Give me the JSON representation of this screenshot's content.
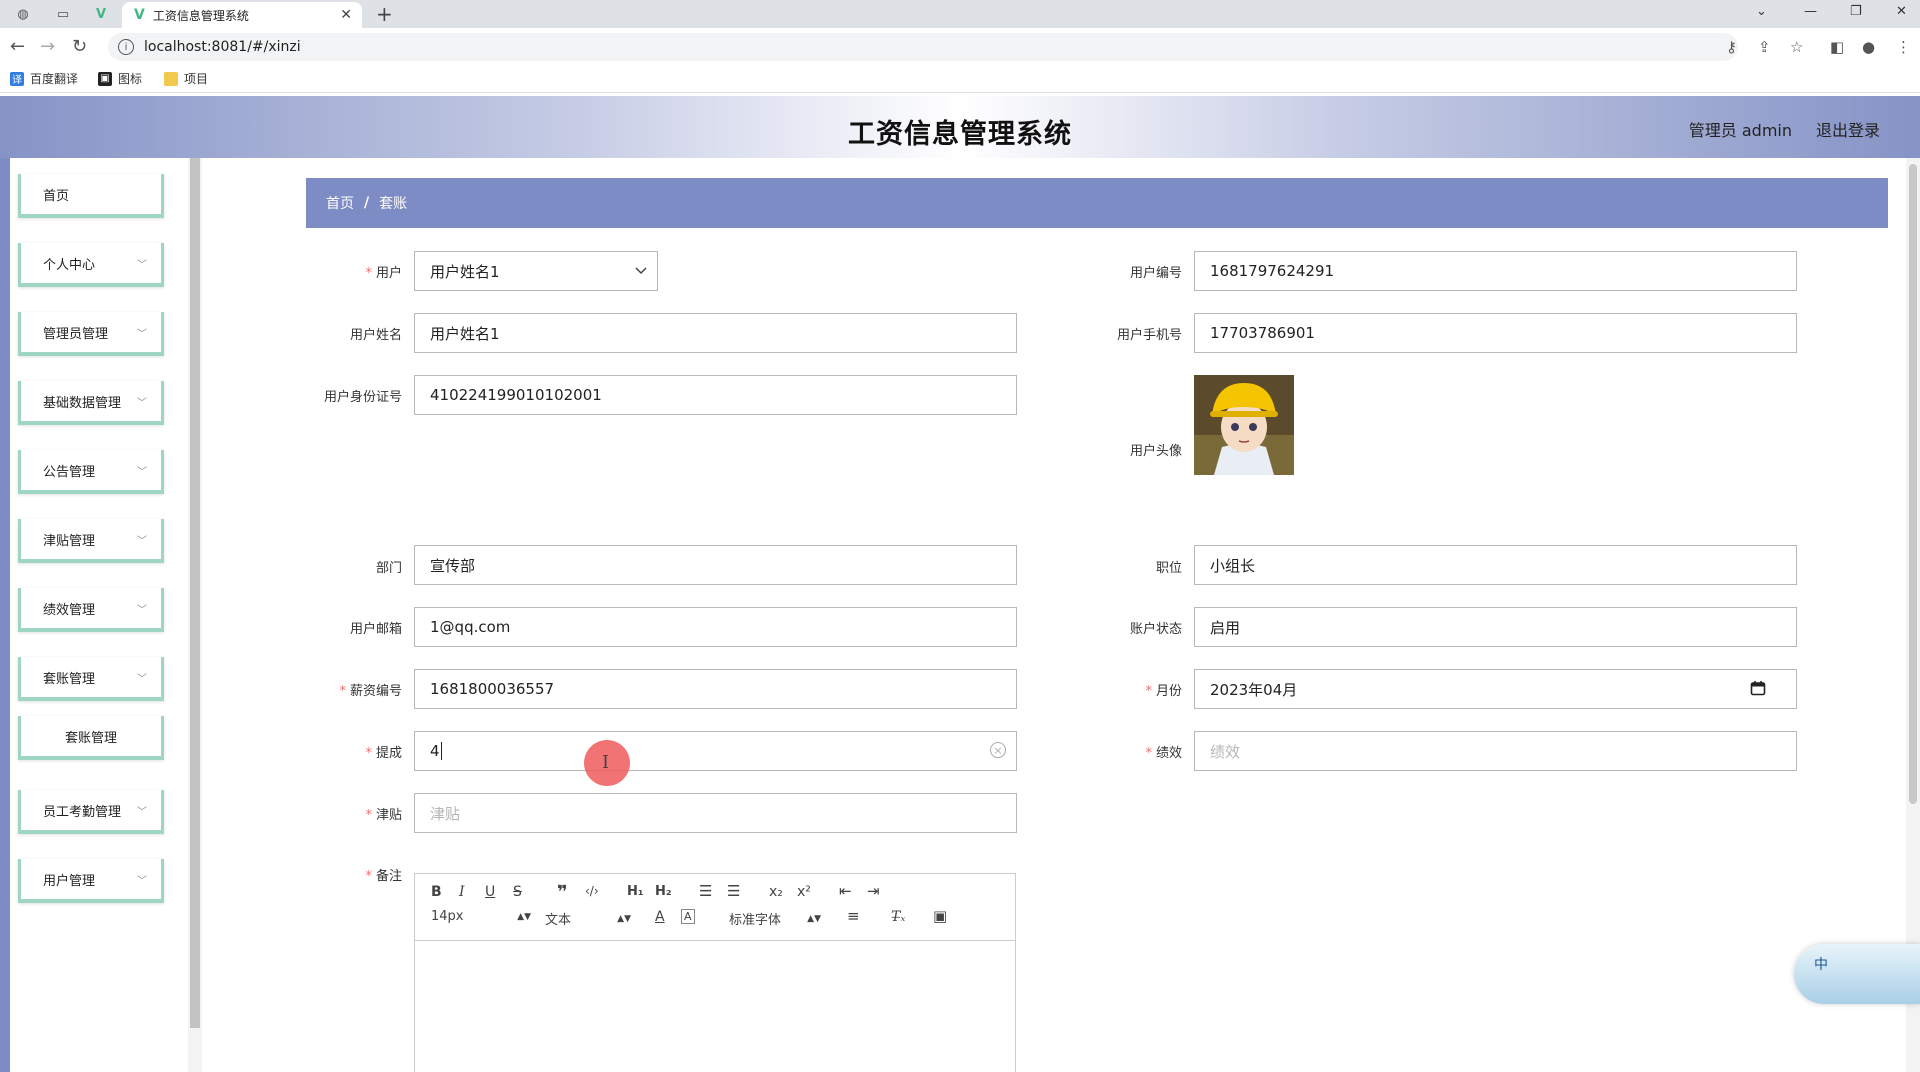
{
  "browser": {
    "tab_title": "工资信息管理系统",
    "url": "localhost:8081/#/xinzi",
    "bookmarks": [
      "百度翻译",
      "图标",
      "项目"
    ]
  },
  "header": {
    "title": "工资信息管理系统",
    "user": "管理员 admin",
    "logout": "退出登录"
  },
  "sidebar": {
    "items": [
      {
        "label": "首页"
      },
      {
        "label": "个人中心"
      },
      {
        "label": "管理员管理"
      },
      {
        "label": "基础数据管理"
      },
      {
        "label": "公告管理"
      },
      {
        "label": "津贴管理"
      },
      {
        "label": "绩效管理"
      },
      {
        "label": "套账管理"
      },
      {
        "label": "套账管理"
      },
      {
        "label": "员工考勤管理"
      },
      {
        "label": "用户管理"
      }
    ]
  },
  "breadcrumb": {
    "home": "首页",
    "sep": "/",
    "current": "套账"
  },
  "form": {
    "user": {
      "label": "用户",
      "value": "用户姓名1"
    },
    "user_no": {
      "label": "用户编号",
      "value": "1681797624291"
    },
    "user_name": {
      "label": "用户姓名",
      "value": "用户姓名1"
    },
    "user_phone": {
      "label": "用户手机号",
      "value": "17703786901"
    },
    "user_id_card": {
      "label": "用户身份证号",
      "value": "410224199010102001"
    },
    "user_avatar": {
      "label": "用户头像"
    },
    "department": {
      "label": "部门",
      "value": "宣传部"
    },
    "position": {
      "label": "职位",
      "value": "小组长"
    },
    "email": {
      "label": "用户邮箱",
      "value": "1@qq.com"
    },
    "account_status": {
      "label": "账户状态",
      "value": "启用"
    },
    "salary_no": {
      "label": "薪资编号",
      "value": "1681800036557"
    },
    "month": {
      "label": "月份",
      "value": "2023年04月"
    },
    "commission": {
      "label": "提成",
      "value": "4"
    },
    "performance": {
      "label": "绩效",
      "placeholder": "绩效"
    },
    "allowance": {
      "label": "津贴",
      "placeholder": "津贴"
    },
    "remark": {
      "label": "备注"
    },
    "required_mark": "*"
  },
  "editor": {
    "font_size": "14px",
    "text_type": "文本",
    "font_family": "标准字体"
  },
  "ime": {
    "label": "中"
  }
}
